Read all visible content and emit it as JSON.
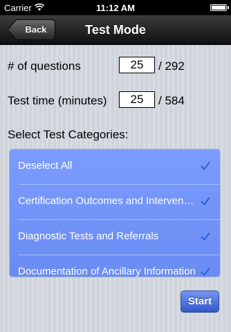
{
  "status_bar": {
    "carrier": "Carrier",
    "time": "11:12 AM"
  },
  "nav": {
    "title": "Test Mode",
    "back_label": "Back"
  },
  "form": {
    "questions_label": "# of questions",
    "questions_value": "25",
    "questions_total": "/ 292",
    "time_label": "Test time (minutes)",
    "time_value": "25",
    "time_total": "/ 584",
    "categories_label": "Select Test Categories:"
  },
  "categories": [
    {
      "label": "Deselect All",
      "checked": true
    },
    {
      "label": "Certification Outcomes and Interventions",
      "checked": true
    },
    {
      "label": "Diagnostic Tests and Referrals",
      "checked": true
    },
    {
      "label": "Documentation of Ancillary Information",
      "checked": true
    }
  ],
  "actions": {
    "start_label": "Start"
  },
  "colors": {
    "list_background": "#7b9cff",
    "checkmark": "#2e5fd8",
    "start_button": "#3f66d8"
  }
}
